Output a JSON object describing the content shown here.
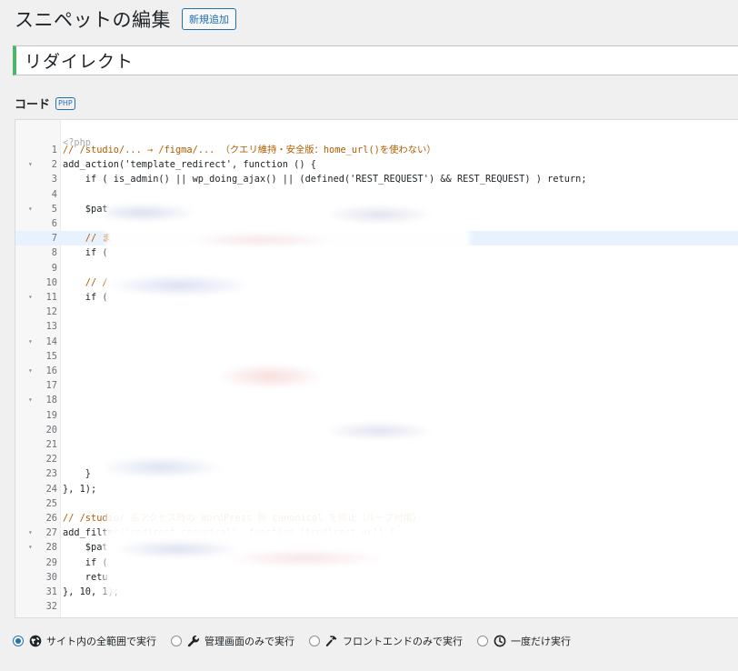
{
  "page": {
    "title": "スニペットの編集",
    "add_new_label": "新規追加"
  },
  "snippet": {
    "title": "リダイレクト"
  },
  "code_section": {
    "label": "コード",
    "badge": "PHP",
    "php_open_tag": "<?php"
  },
  "code_lines": [
    {
      "n": "1",
      "fold": false,
      "text": "// /studio/... → /figma/... （クエリ維持・安全版：home_url()を使わない）",
      "kind": "comment"
    },
    {
      "n": "2",
      "fold": true,
      "text": "add_action('template_redirect', function () {",
      "kind": "code"
    },
    {
      "n": "3",
      "fold": false,
      "text": "    if ( is_admin() || wp_doing_ajax() || (defined('REST_REQUEST') && REST_REQUEST) ) return;",
      "kind": "code"
    },
    {
      "n": "4",
      "fold": false,
      "text": "",
      "kind": "code"
    },
    {
      "n": "5",
      "fold": true,
      "text": "    $pat",
      "kind": "code"
    },
    {
      "n": "6",
      "fold": false,
      "text": "",
      "kind": "code"
    },
    {
      "n": "7",
      "fold": false,
      "text": "    // ま",
      "kind": "comment"
    },
    {
      "n": "8",
      "fold": false,
      "text": "    if (",
      "kind": "code"
    },
    {
      "n": "9",
      "fold": false,
      "text": "",
      "kind": "code"
    },
    {
      "n": "10",
      "fold": false,
      "text": "    // /",
      "kind": "comment"
    },
    {
      "n": "11",
      "fold": true,
      "text": "    if (",
      "kind": "code"
    },
    {
      "n": "12",
      "fold": false,
      "text": "",
      "kind": "code"
    },
    {
      "n": "13",
      "fold": false,
      "text": "",
      "kind": "code"
    },
    {
      "n": "14",
      "fold": true,
      "text": "",
      "kind": "code"
    },
    {
      "n": "15",
      "fold": false,
      "text": "",
      "kind": "code"
    },
    {
      "n": "16",
      "fold": true,
      "text": "",
      "kind": "code"
    },
    {
      "n": "17",
      "fold": false,
      "text": "",
      "kind": "code"
    },
    {
      "n": "18",
      "fold": true,
      "text": "",
      "kind": "code"
    },
    {
      "n": "19",
      "fold": false,
      "text": "",
      "kind": "code"
    },
    {
      "n": "20",
      "fold": false,
      "text": "",
      "kind": "code"
    },
    {
      "n": "21",
      "fold": false,
      "text": "",
      "kind": "code"
    },
    {
      "n": "22",
      "fold": false,
      "text": "",
      "kind": "code"
    },
    {
      "n": "23",
      "fold": false,
      "text": "    }",
      "kind": "code"
    },
    {
      "n": "24",
      "fold": false,
      "text": "}, 1);",
      "kind": "code"
    },
    {
      "n": "25",
      "fold": false,
      "text": "",
      "kind": "code"
    },
    {
      "n": "26",
      "fold": false,
      "text": "// /studio/ 系アクセス時の WordPress 側 canonical を抑止（ループ対策）",
      "kind": "comment"
    },
    {
      "n": "27",
      "fold": true,
      "text": "add_filter('redirect_canonical', function ($redirect_url) {",
      "kind": "code"
    },
    {
      "n": "28",
      "fold": true,
      "text": "    $pat",
      "kind": "code"
    },
    {
      "n": "29",
      "fold": false,
      "text": "    if (",
      "kind": "code"
    },
    {
      "n": "30",
      "fold": false,
      "text": "    retu",
      "kind": "code"
    },
    {
      "n": "31",
      "fold": false,
      "text": "}, 10, 1);",
      "kind": "code"
    },
    {
      "n": "32",
      "fold": false,
      "text": "",
      "kind": "code"
    }
  ],
  "active_line": "7",
  "scope_options": [
    {
      "label": "サイト内の全範囲で実行",
      "icon": "globe-icon",
      "checked": true
    },
    {
      "label": "管理画面のみで実行",
      "icon": "wrench-icon",
      "checked": false
    },
    {
      "label": "フロントエンドのみで実行",
      "icon": "hammer-icon",
      "checked": false
    },
    {
      "label": "一度だけ実行",
      "icon": "clock-icon",
      "checked": false
    }
  ],
  "colors": {
    "accent": "#2271b1",
    "title_border": "#4ab866",
    "comment": "#b35c00"
  }
}
